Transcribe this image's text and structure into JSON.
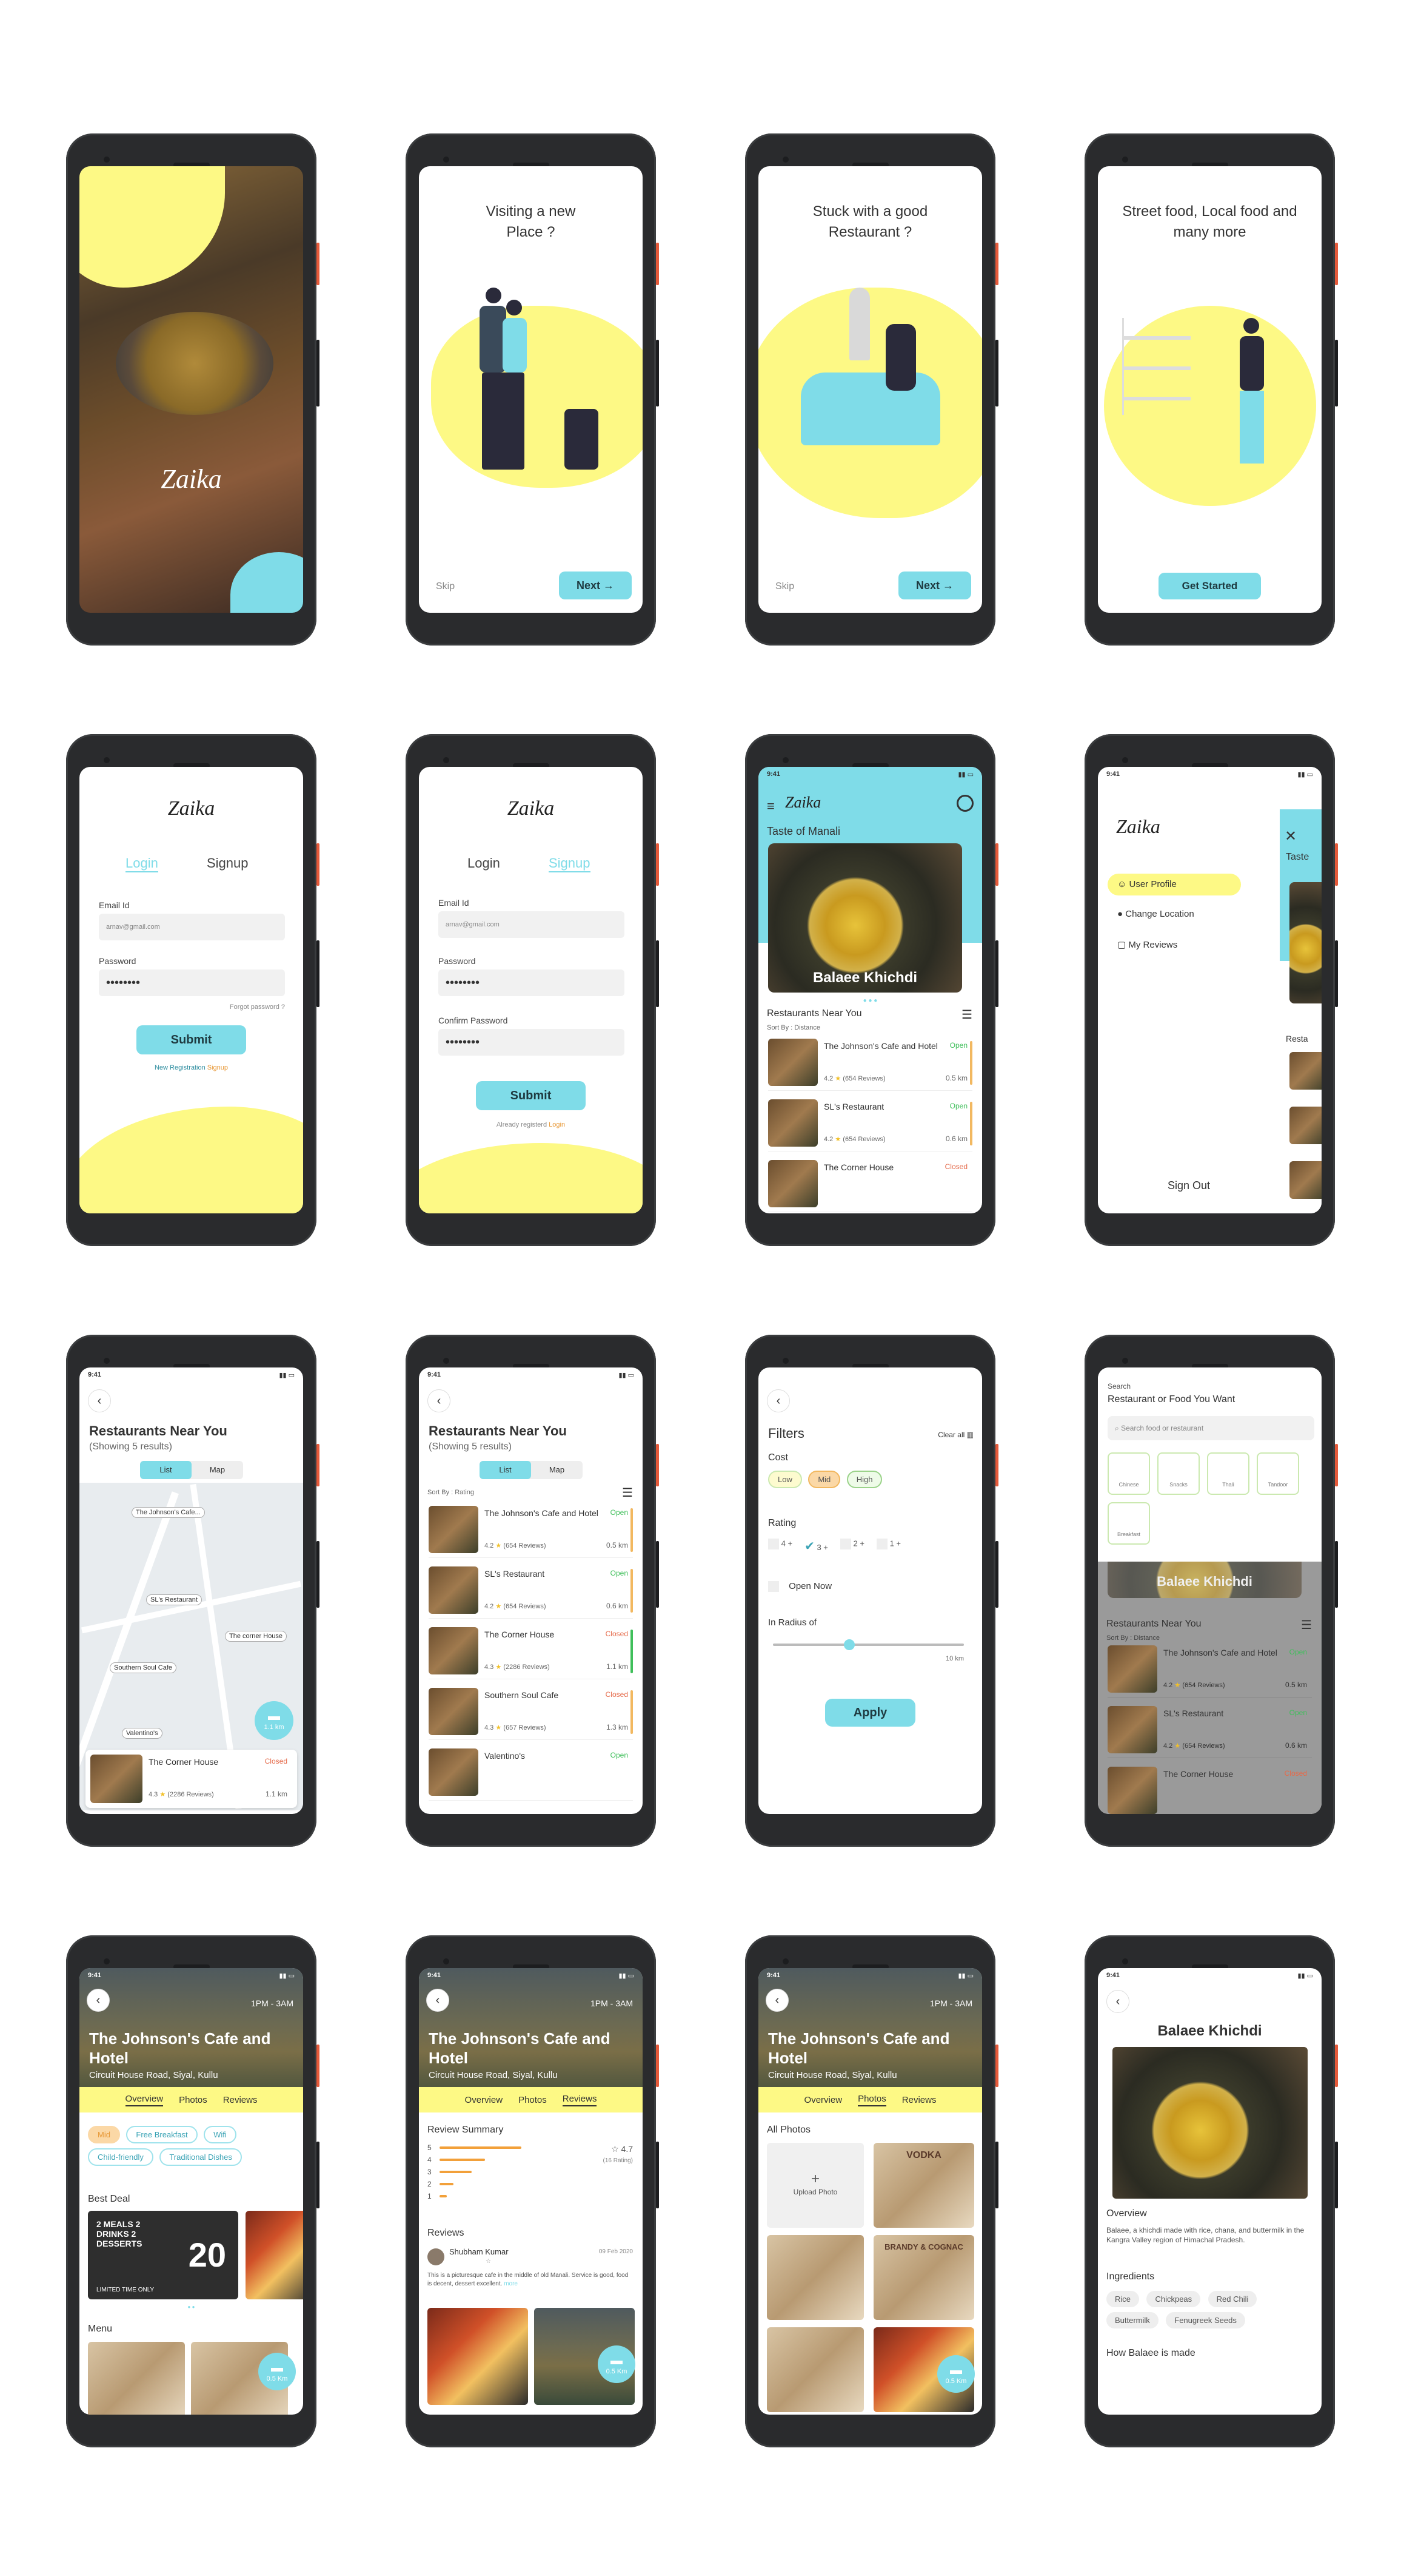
{
  "app_name": "Zaika",
  "colors": {
    "yellow": "#fdf985",
    "cyan": "#7fdce8",
    "open": "#3fbf5a",
    "closed": "#e56a4a",
    "dark": "#2a2b2d"
  },
  "onboarding": [
    {
      "title": "Visiting a new Place ?",
      "skip": "Skip",
      "next": "Next"
    },
    {
      "title": "Stuck with a good Restaurant ?",
      "skip": "Skip",
      "next": "Next"
    },
    {
      "title": "Street food, Local food and many more",
      "cta": "Get Started"
    }
  ],
  "login": {
    "tab_login": "Login",
    "tab_signup": "Signup",
    "email_label": "Email Id",
    "email_value": "arnav@gmail.com",
    "password_label": "Password",
    "password_value": "••••••••",
    "forgot": "Forgot password ?",
    "submit": "Submit",
    "new_reg": "New Registration",
    "signup_link": "Signup"
  },
  "signup": {
    "tab_login": "Login",
    "tab_signup": "Signup",
    "email_label": "Email Id",
    "email_value": "arnav@gmail.com",
    "password_label": "Password",
    "password_value": "••••••••",
    "confirm_label": "Confirm Password",
    "confirm_value": "••••••••",
    "submit": "Submit",
    "already": "Already registerd",
    "login_link": "Login"
  },
  "status_time": "9:41",
  "home": {
    "subtitle": "Taste of Manali",
    "dish": "Balaee Khichdi",
    "section": "Restaurants Near You",
    "sort": "Sort By : Distance",
    "items": [
      {
        "name": "The Johnson's Cafe and Hotel",
        "status": "Open",
        "rating": "4.2",
        "reviews": "(654 Reviews)",
        "distance": "0.5 km"
      },
      {
        "name": "SL's Restaurant",
        "status": "Open",
        "rating": "4.2",
        "reviews": "(654 Reviews)",
        "distance": "0.6 km"
      },
      {
        "name": "The Corner House",
        "status": "Closed"
      }
    ]
  },
  "drawer": {
    "items": [
      "User Profile",
      "Change Location",
      "My Reviews"
    ],
    "signout": "Sign Out",
    "peek_1": "Taste",
    "peek_2": "Resta"
  },
  "near": {
    "title": "Restaurants Near You",
    "count": "(Showing 5 results)",
    "tab_list": "List",
    "tab_map": "Map",
    "sort": "Sort By : Rating",
    "map_pins": [
      "The Johnson's Cafe...",
      "SL's Restaurant",
      "The corner House",
      "Southern Soul Cafe",
      "Valentino's"
    ],
    "map_distance": "1.1 km",
    "map_card": {
      "name": "The Corner House",
      "status": "Closed",
      "rating": "4.3",
      "reviews": "(2286 Reviews)",
      "distance": "1.1 km"
    },
    "items": [
      {
        "name": "The Johnson's Cafe and Hotel",
        "status": "Open",
        "rating": "4.2",
        "reviews": "(654 Reviews)",
        "distance": "0.5 km"
      },
      {
        "name": "SL's Restaurant",
        "status": "Open",
        "rating": "4.2",
        "reviews": "(654 Reviews)",
        "distance": "0.6 km"
      },
      {
        "name": "The Corner House",
        "status": "Closed",
        "rating": "4.3",
        "reviews": "(2286 Reviews)",
        "distance": "1.1 km"
      },
      {
        "name": "Southern Soul Cafe",
        "status": "Closed",
        "rating": "4.3",
        "reviews": "(657 Reviews)",
        "distance": "1.3 km"
      },
      {
        "name": "Valentino's",
        "status": "Open"
      }
    ]
  },
  "filters": {
    "title": "Filters",
    "clear": "Clear all",
    "cost": "Cost",
    "cost_options": [
      "Low",
      "Mid",
      "High"
    ],
    "rating": "Rating",
    "rating_options": [
      "4 +",
      "3 +",
      "2 +",
      "1 +"
    ],
    "open_now": "Open Now",
    "radius": "In Radius of",
    "radius_value": 0.4,
    "radius_max": "10 km",
    "apply": "Apply"
  },
  "search": {
    "label": "Search",
    "heading": "Restaurant or Food You Want",
    "placeholder": "Search food or restaurant",
    "categories": [
      "Chinese",
      "Snacks",
      "Thali",
      "Tandoor",
      "Breakfast"
    ],
    "dish": "Balaee Khichdi",
    "section": "Restaurants Near You",
    "sort": "Sort By : Distance",
    "items": [
      {
        "name": "The Johnson's Cafe and Hotel",
        "status": "Open",
        "rating": "4.2",
        "reviews": "(654 Reviews)",
        "distance": "0.5 km"
      },
      {
        "name": "SL's Restaurant",
        "status": "Open",
        "rating": "4.2",
        "reviews": "(654 Reviews)",
        "distance": "0.6 km"
      },
      {
        "name": "The Corner House",
        "status": "Closed"
      }
    ]
  },
  "restaurant": {
    "name": "The Johnson's Cafe and Hotel",
    "address": "Circuit House Road, Siyal, Kullu",
    "hours": "1PM - 3AM",
    "tabs": [
      "Overview",
      "Photos",
      "Reviews"
    ],
    "tags": [
      "Mid",
      "Free Breakfast",
      "Wifi",
      "Child-friendly",
      "Traditional Dishes"
    ],
    "best_deal": "Best Deal",
    "deal_1": "2 MEALS 2 DRINKS 2 DESSERTS",
    "deal_2": "20",
    "deal_3": "LIMITED TIME ONLY",
    "menu": "Menu",
    "distance": "0.5 Km"
  },
  "reviews": {
    "summary": "Review Summary",
    "rating": "4.7",
    "rating_count": "(16 Rating)",
    "stars": [
      5,
      4,
      3,
      2,
      1
    ],
    "bar_values": [
      0.9,
      0.5,
      0.35,
      0.15,
      0.08
    ],
    "title": "Reviews",
    "review": {
      "author": "Shubham Kumar",
      "date": "09 Feb 2020",
      "text": "This is a picturesque cafe in the middle of old Manali. Service is good, food is decent, dessert excellent.",
      "more": "more"
    }
  },
  "photos": {
    "title": "All Photos",
    "upload": "Upload Photo",
    "menu_1": "VODKA",
    "menu_2": "BRANDY & COGNAC"
  },
  "dish": {
    "title": "Balaee Khichdi",
    "overview": "Overview",
    "overview_text": "Balaee, a khichdi made with rice, chana, and buttermilk in the Kangra Valley region of Himachal Pradesh.",
    "ingredients": "Ingredients",
    "ingredient_list": [
      "Rice",
      "Chickpeas",
      "Red Chili",
      "Buttermilk",
      "Fenugreek Seeds"
    ],
    "how": "How Balaee is made"
  }
}
